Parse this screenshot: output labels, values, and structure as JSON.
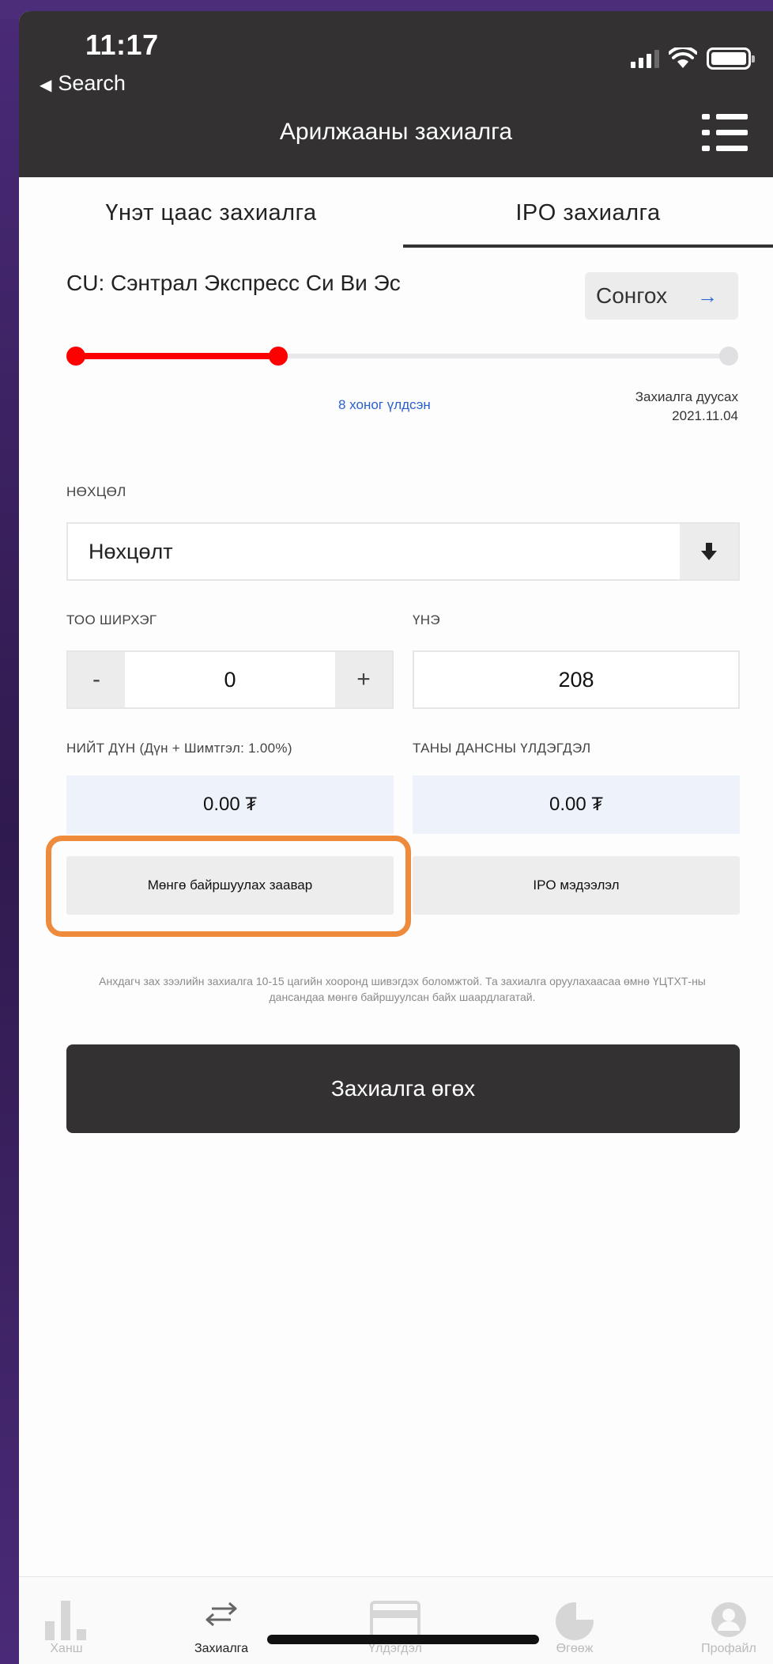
{
  "status_bar": {
    "time": "11:17",
    "back_label": "Search"
  },
  "header": {
    "title": "Арилжааны захиалга"
  },
  "tabs": [
    {
      "label": "Үнэт цаас захиалга",
      "active": false
    },
    {
      "label": "IPO захиалга",
      "active": true
    }
  ],
  "security": {
    "name": "CU: Сэнтрал Экспресс Си Ви Эс",
    "choose_label": "Сонгох",
    "choose_arrow": "→"
  },
  "timeline": {
    "progress_fraction": 0.31,
    "days_left": "8 хоног үлдсэн",
    "deadline_label": "Захиалга дуусах",
    "deadline_date": "2021.11.04"
  },
  "form": {
    "condition_label": "НӨХЦӨЛ",
    "condition_value": "Нөхцөлт",
    "quantity_label": "ТОО ШИРХЭГ",
    "quantity_value": "0",
    "minus": "-",
    "plus": "+",
    "price_label": "ҮНЭ",
    "price_value": "208",
    "total_label": "НИЙТ ДҮН (Дүн + Шимтгэл: 1.00%)",
    "total_value": "0.00 ₮",
    "balance_label": "ТАНЫ ДАНСНЫ ҮЛДЭГДЭЛ",
    "balance_value": "0.00 ₮"
  },
  "buttons": {
    "deposit_instructions": "Мөнгө байршуулах заавар",
    "ipo_info": "IPO мэдээлэл",
    "submit": "Захиалга өгөх"
  },
  "note": "Анхдагч зах зээлийн захиалга 10-15 цагийн хооронд шивэгдэх боломжтой. Та захиалга оруулахаасаа өмнө ҮЦТХТ-ны дансандаа мөнгө байршуулсан байх шаардлагатай.",
  "colors": {
    "header_bg": "#333131",
    "progress_red": "#ff0000",
    "accent_blue": "#2a5fd0",
    "highlight_orange": "#ee8a3c"
  },
  "tabbar": [
    {
      "label": "Ханш",
      "icon": "bar-chart-icon",
      "active": false
    },
    {
      "label": "Захиалга",
      "icon": "swap-arrows-icon",
      "active": true
    },
    {
      "label": "Үлдэгдэл",
      "icon": "card-icon",
      "active": false
    },
    {
      "label": "Өгөөж",
      "icon": "pie-chart-icon",
      "active": false
    },
    {
      "label": "Профайл",
      "icon": "profile-icon",
      "active": false
    }
  ]
}
